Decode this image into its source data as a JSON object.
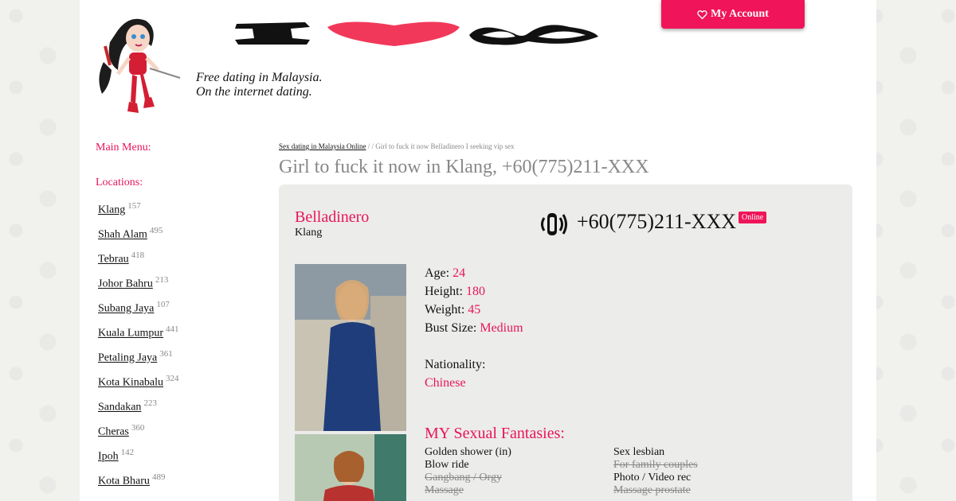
{
  "header": {
    "tagline_line1": "Free dating in Malaysia.",
    "tagline_line2": "On the internet dating.",
    "account_button": "My Account"
  },
  "sidebar": {
    "main_menu_title": "Main Menu:",
    "locations_title": "Locations:",
    "locations": [
      {
        "name": "Klang",
        "count": "157"
      },
      {
        "name": "Shah Alam",
        "count": "495"
      },
      {
        "name": "Tebrau",
        "count": "418"
      },
      {
        "name": "Johor Bahru",
        "count": "213"
      },
      {
        "name": "Subang Jaya",
        "count": "107"
      },
      {
        "name": "Kuala Lumpur",
        "count": "441"
      },
      {
        "name": "Petaling Jaya",
        "count": "361"
      },
      {
        "name": "Kota Kinabalu",
        "count": "324"
      },
      {
        "name": "Sandakan",
        "count": "223"
      },
      {
        "name": "Cheras",
        "count": "360"
      },
      {
        "name": "Ipoh",
        "count": "142"
      },
      {
        "name": "Kota Bharu",
        "count": "489"
      }
    ]
  },
  "breadcrumb": {
    "link": "Sex dating in Malaysia Online",
    "rest": " / / Girl to fuck it now Belladinero I seeking vip sex"
  },
  "page_title": "Girl to fuck it now in Klang, +60(775)211-XXX",
  "profile": {
    "name": "Belladinero",
    "city": "Klang",
    "phone": "+60(775)211-XXX",
    "status": "Online",
    "age_label": "Age:",
    "age": "24",
    "height_label": "Height:",
    "height": "180",
    "weight_label": "Weight:",
    "weight": "45",
    "bust_label": "Bust Size:",
    "bust": "Medium",
    "nationality_label": "Nationality:",
    "nationality": "Chinese"
  },
  "fantasies": {
    "title": "MY Sexual Fantasies:",
    "items": [
      {
        "text": "Golden shower (in)",
        "active": true
      },
      {
        "text": "Sex lesbian",
        "active": true
      },
      {
        "text": "Blow ride",
        "active": true
      },
      {
        "text": "For family couples",
        "active": false
      },
      {
        "text": "Gangbang / Orgy",
        "active": false
      },
      {
        "text": "Photo / Video rec",
        "active": true
      },
      {
        "text": "Massage",
        "active": false
      },
      {
        "text": "Massage prostate",
        "active": false
      }
    ]
  },
  "colors": {
    "accent": "#f0145a",
    "text_pink": "#e8145c"
  }
}
